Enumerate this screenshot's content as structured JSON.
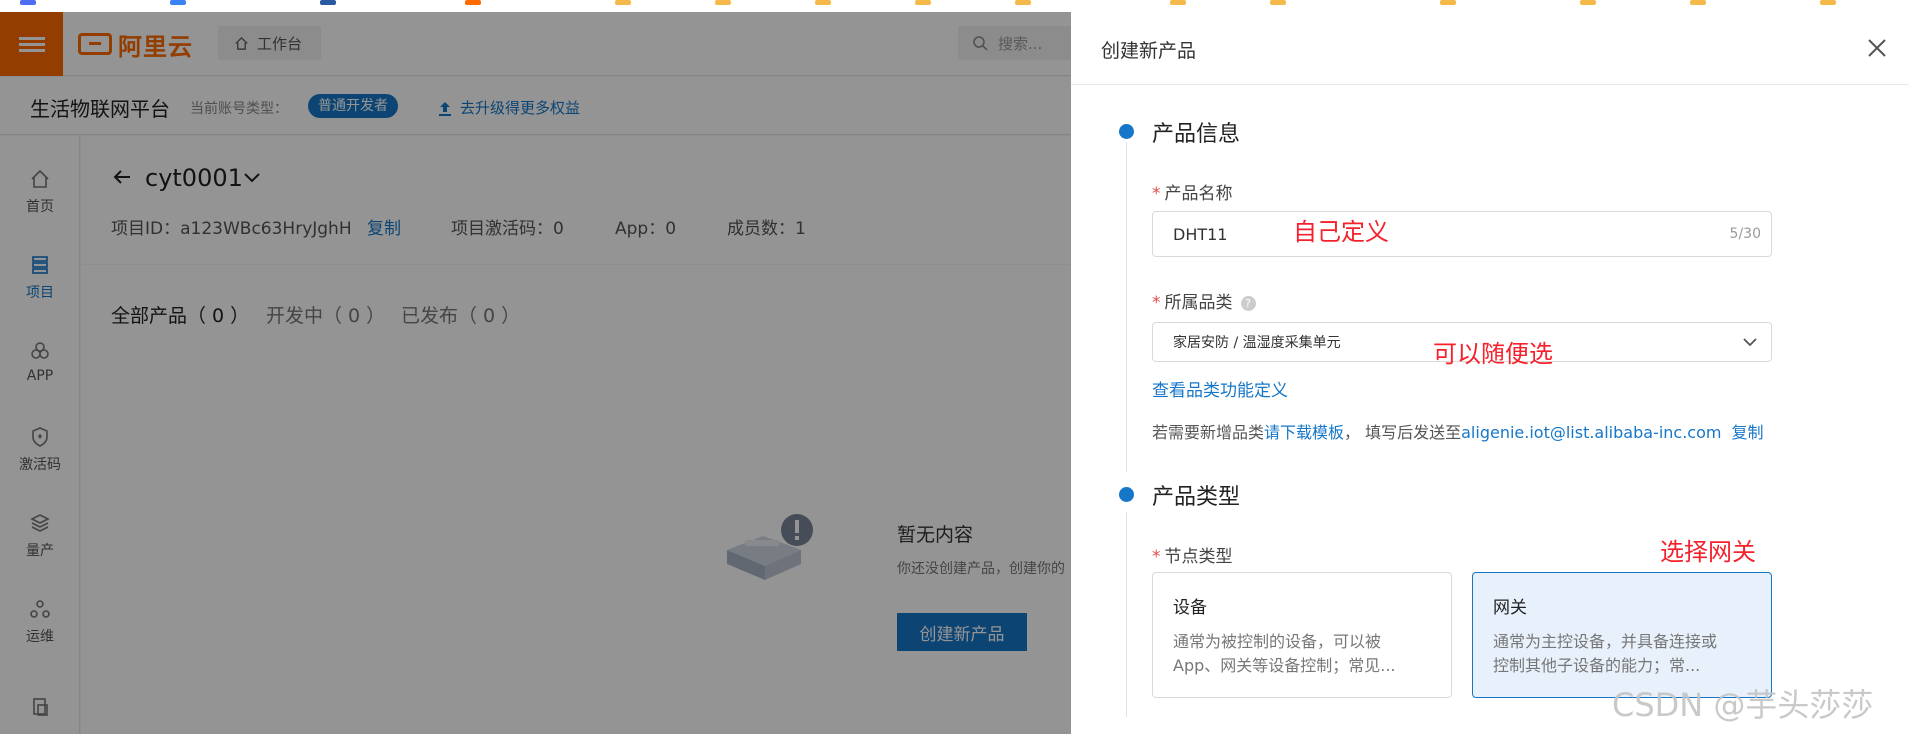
{
  "topbar": {
    "logo_text": "阿里云",
    "workbench_label": "工作台",
    "search_placeholder": "搜索..."
  },
  "subbar": {
    "platform_title": "生活物联网平台",
    "account_type_label": "当前账号类型：",
    "account_type_badge": "普通开发者",
    "upgrade_link": "去升级得更多权益"
  },
  "sidebar": {
    "items": [
      {
        "label": "首页",
        "icon": "home-icon"
      },
      {
        "label": "项目",
        "icon": "project-icon",
        "active": true
      },
      {
        "label": "APP",
        "icon": "app-icon"
      },
      {
        "label": "激活码",
        "icon": "activation-code-icon"
      },
      {
        "label": "量产",
        "icon": "mass-production-icon"
      },
      {
        "label": "运维",
        "icon": "operations-icon"
      }
    ]
  },
  "project": {
    "name": "cyt0001",
    "id_text": "项目ID：a123WBc63HryJghH",
    "copy_label": "复制",
    "activation_text": "项目激活码：0",
    "app_text": "App：0",
    "members_text": "成员数：1"
  },
  "tabs": [
    {
      "label": "全部产品（ 0 ）",
      "active": true
    },
    {
      "label": "开发中（ 0 ）"
    },
    {
      "label": "已发布（ 0 ）"
    }
  ],
  "empty": {
    "title": "暂无内容",
    "desc": "你还没创建产品，创建你的",
    "create_button": "创建新产品"
  },
  "drawer": {
    "title": "创建新产品",
    "section_product_info": "产品信息",
    "product_name_label": "产品名称",
    "product_name_value": "DHT11",
    "product_name_count": "5/30",
    "category_label": "所属品类",
    "category_value": "家居安防 / 温湿度采集单元",
    "category_link": "查看品类功能定义",
    "notice_prefix": "若需要新增品类",
    "notice_download": "请下载模板",
    "notice_mid": "， 填写后发送至",
    "notice_email": "aligenie.iot@list.alibaba-inc.com",
    "notice_copy": "复制",
    "section_product_type": "产品类型",
    "node_type_label": "节点类型",
    "cards": [
      {
        "title": "设备",
        "desc_line1": "通常为被控制的设备，可以被",
        "desc_line2": "App、网关等设备控制；常见...",
        "selected": false
      },
      {
        "title": "网关",
        "desc_line1": "通常为主控设备，并具备连接或",
        "desc_line2": "控制其他子设备的能力；常...",
        "selected": true
      }
    ]
  },
  "annotations": {
    "name_note": "自己定义",
    "category_note": "可以随便选",
    "gateway_note": "选择网关"
  },
  "watermark": "CSDN @芋头莎莎",
  "colors": {
    "brand_orange": "#ff6a00",
    "primary_blue": "#1677c8",
    "annotation_red": "#f5222d"
  }
}
